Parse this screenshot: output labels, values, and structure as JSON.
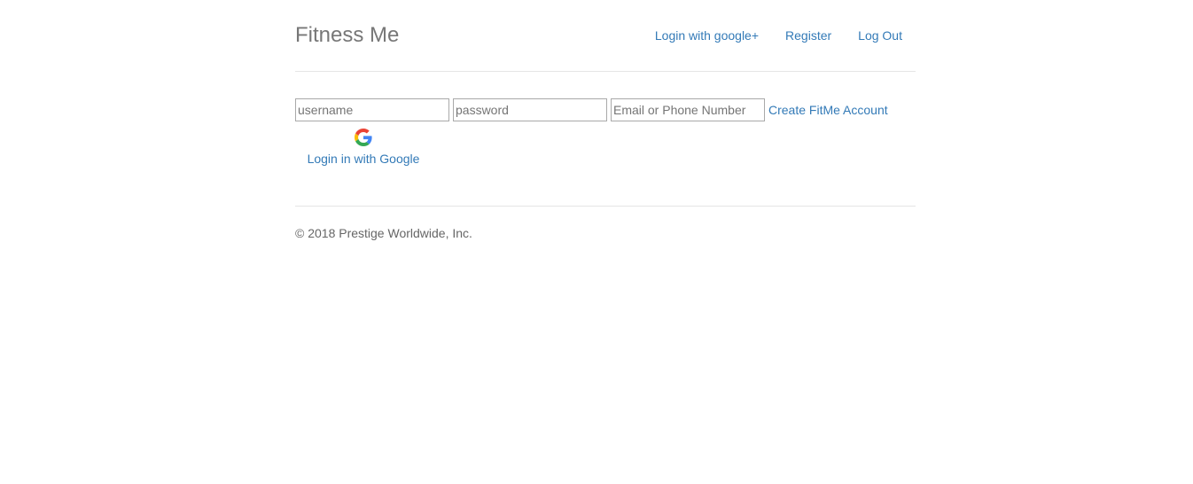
{
  "header": {
    "brand": "Fitness Me",
    "nav": [
      {
        "label": "Login with google+"
      },
      {
        "label": "Register"
      },
      {
        "label": "Log Out"
      }
    ]
  },
  "login_form": {
    "username_placeholder": "username",
    "password_placeholder": "password",
    "contact_placeholder": "Email or Phone Number",
    "create_account_label": "Create FitMe Account"
  },
  "google_login": {
    "icon": "google-icon",
    "label": "Login in with Google"
  },
  "footer": {
    "copyright": "© 2018 Prestige Worldwide, Inc."
  },
  "colors": {
    "link": "#337ab7",
    "brand": "#777777",
    "divider": "#e5e5e5"
  }
}
